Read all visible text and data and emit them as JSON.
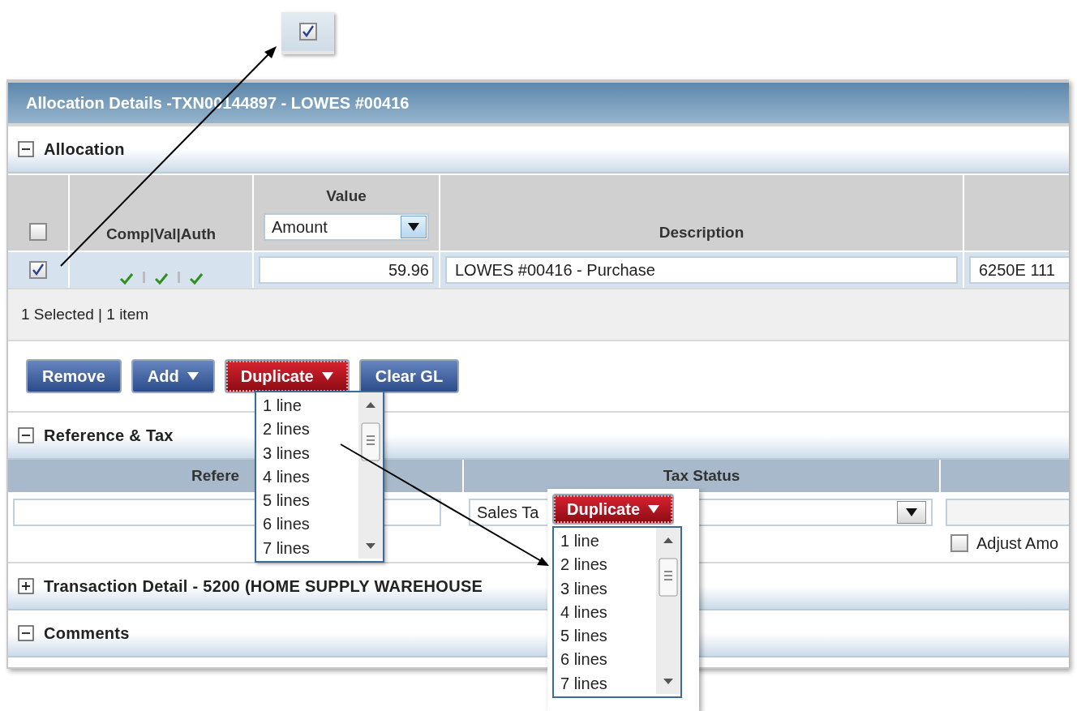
{
  "callout_checkbox": {
    "checked": true
  },
  "panel": {
    "title": "Allocation Details -TXN00144897 - LOWES #00416"
  },
  "allocation": {
    "label": "Allocation",
    "expanded": true,
    "header": {
      "select_all_checked": false,
      "columns": [
        "Comp|Val|Auth",
        "Value",
        "Description"
      ],
      "value_select": "Amount"
    },
    "rows": [
      {
        "selected": true,
        "comp": true,
        "val": true,
        "auth": true,
        "amount": "59.96",
        "description": "LOWES #00416 - Purchase",
        "column_5": "6250E 111"
      }
    ],
    "status": "1 Selected | 1 item",
    "buttons": [
      {
        "label": "Remove",
        "kind": "plain",
        "active": false
      },
      {
        "label": "Add",
        "kind": "menu",
        "active": false
      },
      {
        "label": "Duplicate",
        "kind": "menu",
        "active": true
      },
      {
        "label": "Clear GL",
        "kind": "plain",
        "active": false
      }
    ],
    "duplicate_menu": [
      "1 line",
      "2 lines",
      "3 lines",
      "4 lines",
      "5 lines",
      "6 lines",
      "7 lines"
    ]
  },
  "reference_tax": {
    "label": "Reference & Tax",
    "expanded": true,
    "columns": [
      "Refere",
      "Tax Status"
    ],
    "tax_status": "Sales Ta",
    "adjust": {
      "label": "Adjust Amo",
      "checked": false
    }
  },
  "transaction_detail": {
    "label": "Transaction Detail - 5200 (HOME SUPPLY WAREHOUSE",
    "expanded": false
  },
  "comments": {
    "label": "Comments",
    "expanded": true
  },
  "callout_menu": {
    "button": "Duplicate",
    "items": [
      "1 line",
      "2 lines",
      "3 lines",
      "4 lines",
      "5 lines",
      "6 lines",
      "7 lines"
    ]
  }
}
